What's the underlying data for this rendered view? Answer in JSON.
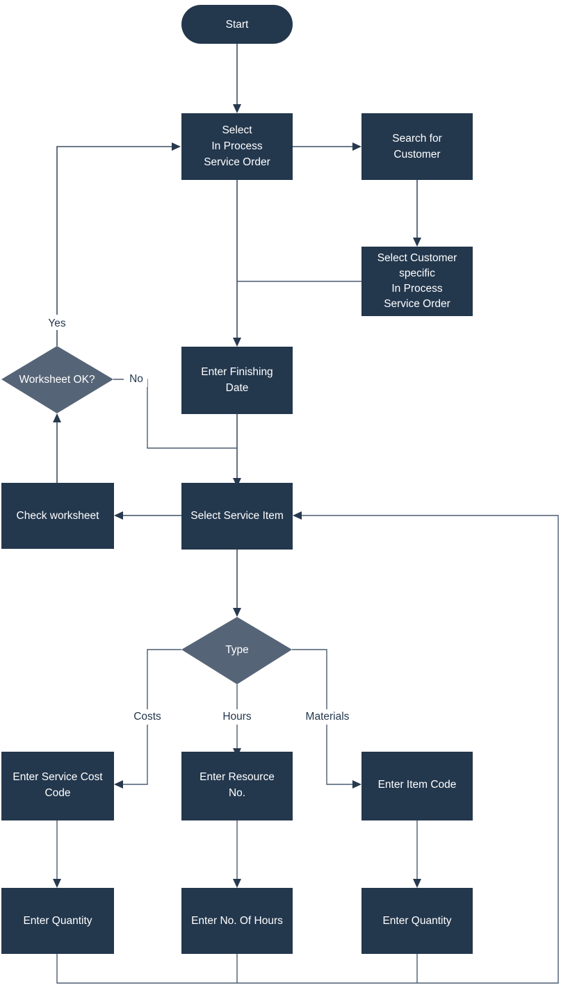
{
  "diagram": {
    "title": "Service Order Worksheet Process Flowchart",
    "colors": {
      "process_fill": "#23374d",
      "decision_fill": "#566477",
      "terminator_fill": "#23374d",
      "connector": "#3b4e63",
      "node_text": "#ffffff",
      "edge_text": "#23374d",
      "background": "#ffffff"
    },
    "nodes": [
      {
        "id": "start",
        "type": "terminator",
        "label": "Start"
      },
      {
        "id": "select_in_process",
        "type": "process",
        "label": "Select\nIn Process\nService Order",
        "lines": [
          "Select",
          "In Process",
          "Service Order"
        ]
      },
      {
        "id": "search_customer",
        "type": "process",
        "label": "Search for\nCustomer",
        "lines": [
          "Search for",
          "Customer"
        ]
      },
      {
        "id": "select_cust_spec",
        "type": "process",
        "label": "Select Customer\nspecific\nIn Process\nService Order",
        "lines": [
          "Select Customer",
          "specific",
          "In Process",
          "Service Order"
        ]
      },
      {
        "id": "enter_finishing",
        "type": "process",
        "label": "Enter Finishing\nDate",
        "lines": [
          "Enter Finishing",
          "Date"
        ]
      },
      {
        "id": "worksheet_ok",
        "type": "decision",
        "label": "Worksheet OK?",
        "lines": [
          "Worksheet OK?"
        ]
      },
      {
        "id": "check_worksheet",
        "type": "process",
        "label": "Check worksheet",
        "lines": [
          "Check worksheet"
        ]
      },
      {
        "id": "select_service_item",
        "type": "process",
        "label": "Select Service Item",
        "lines": [
          "Select Service Item"
        ]
      },
      {
        "id": "type_decision",
        "type": "decision",
        "label": "Type",
        "lines": [
          "Type"
        ]
      },
      {
        "id": "enter_cost_code",
        "type": "process",
        "label": "Enter Service Cost\nCode",
        "lines": [
          "Enter Service Cost",
          "Code"
        ]
      },
      {
        "id": "enter_resource_no",
        "type": "process",
        "label": "Enter Resource\nNo.",
        "lines": [
          "Enter Resource",
          "No."
        ]
      },
      {
        "id": "enter_item_code",
        "type": "process",
        "label": "Enter Item Code",
        "lines": [
          "Enter Item Code"
        ]
      },
      {
        "id": "enter_qty_left",
        "type": "process",
        "label": "Enter Quantity",
        "lines": [
          "Enter Quantity"
        ]
      },
      {
        "id": "enter_hours",
        "type": "process",
        "label": "Enter No. Of Hours",
        "lines": [
          "Enter No. Of Hours"
        ]
      },
      {
        "id": "enter_qty_right",
        "type": "process",
        "label": "Enter Quantity",
        "lines": [
          "Enter Quantity"
        ]
      }
    ],
    "edge_labels": {
      "yes": "Yes",
      "no": "No",
      "costs": "Costs",
      "hours": "Hours",
      "materials": "Materials"
    },
    "edges": [
      {
        "from": "start",
        "to": "select_in_process",
        "label": ""
      },
      {
        "from": "select_in_process",
        "to": "search_customer",
        "label": ""
      },
      {
        "from": "search_customer",
        "to": "select_cust_spec",
        "label": ""
      },
      {
        "from": "select_cust_spec",
        "to": "enter_finishing",
        "label": ""
      },
      {
        "from": "select_in_process",
        "to": "enter_finishing",
        "label": ""
      },
      {
        "from": "enter_finishing",
        "to": "select_service_item",
        "label": ""
      },
      {
        "from": "select_service_item",
        "to": "check_worksheet",
        "label": ""
      },
      {
        "from": "check_worksheet",
        "to": "worksheet_ok",
        "label": ""
      },
      {
        "from": "worksheet_ok",
        "to": "select_in_process",
        "label": "Yes"
      },
      {
        "from": "worksheet_ok",
        "to": "select_service_item",
        "label": "No"
      },
      {
        "from": "select_service_item",
        "to": "type_decision",
        "label": ""
      },
      {
        "from": "type_decision",
        "to": "enter_cost_code",
        "label": "Costs"
      },
      {
        "from": "type_decision",
        "to": "enter_resource_no",
        "label": "Hours"
      },
      {
        "from": "type_decision",
        "to": "enter_item_code",
        "label": "Materials"
      },
      {
        "from": "enter_cost_code",
        "to": "enter_qty_left",
        "label": ""
      },
      {
        "from": "enter_resource_no",
        "to": "enter_hours",
        "label": ""
      },
      {
        "from": "enter_item_code",
        "to": "enter_qty_right",
        "label": ""
      },
      {
        "from": "enter_qty_left",
        "to": "select_service_item",
        "label": ""
      },
      {
        "from": "enter_hours",
        "to": "select_service_item",
        "label": ""
      },
      {
        "from": "enter_qty_right",
        "to": "select_service_item",
        "label": ""
      }
    ]
  },
  "labels": {
    "start": "Start",
    "select_in_process_1": "Select",
    "select_in_process_2": "In Process",
    "select_in_process_3": "Service Order",
    "search_customer_1": "Search for",
    "search_customer_2": "Customer",
    "select_cust_spec_1": "Select Customer",
    "select_cust_spec_2": "specific",
    "select_cust_spec_3": "In Process",
    "select_cust_spec_4": "Service Order",
    "enter_finishing_1": "Enter Finishing",
    "enter_finishing_2": "Date",
    "worksheet_ok": "Worksheet OK?",
    "check_worksheet": "Check worksheet",
    "select_service_item": "Select Service Item",
    "type_decision": "Type",
    "enter_cost_code_1": "Enter Service Cost",
    "enter_cost_code_2": "Code",
    "enter_resource_no_1": "Enter Resource",
    "enter_resource_no_2": "No.",
    "enter_item_code": "Enter Item Code",
    "enter_qty_left": "Enter Quantity",
    "enter_hours": "Enter No. Of Hours",
    "enter_qty_right": "Enter Quantity",
    "yes": "Yes",
    "no": "No",
    "costs": "Costs",
    "hours": "Hours",
    "materials": "Materials"
  }
}
